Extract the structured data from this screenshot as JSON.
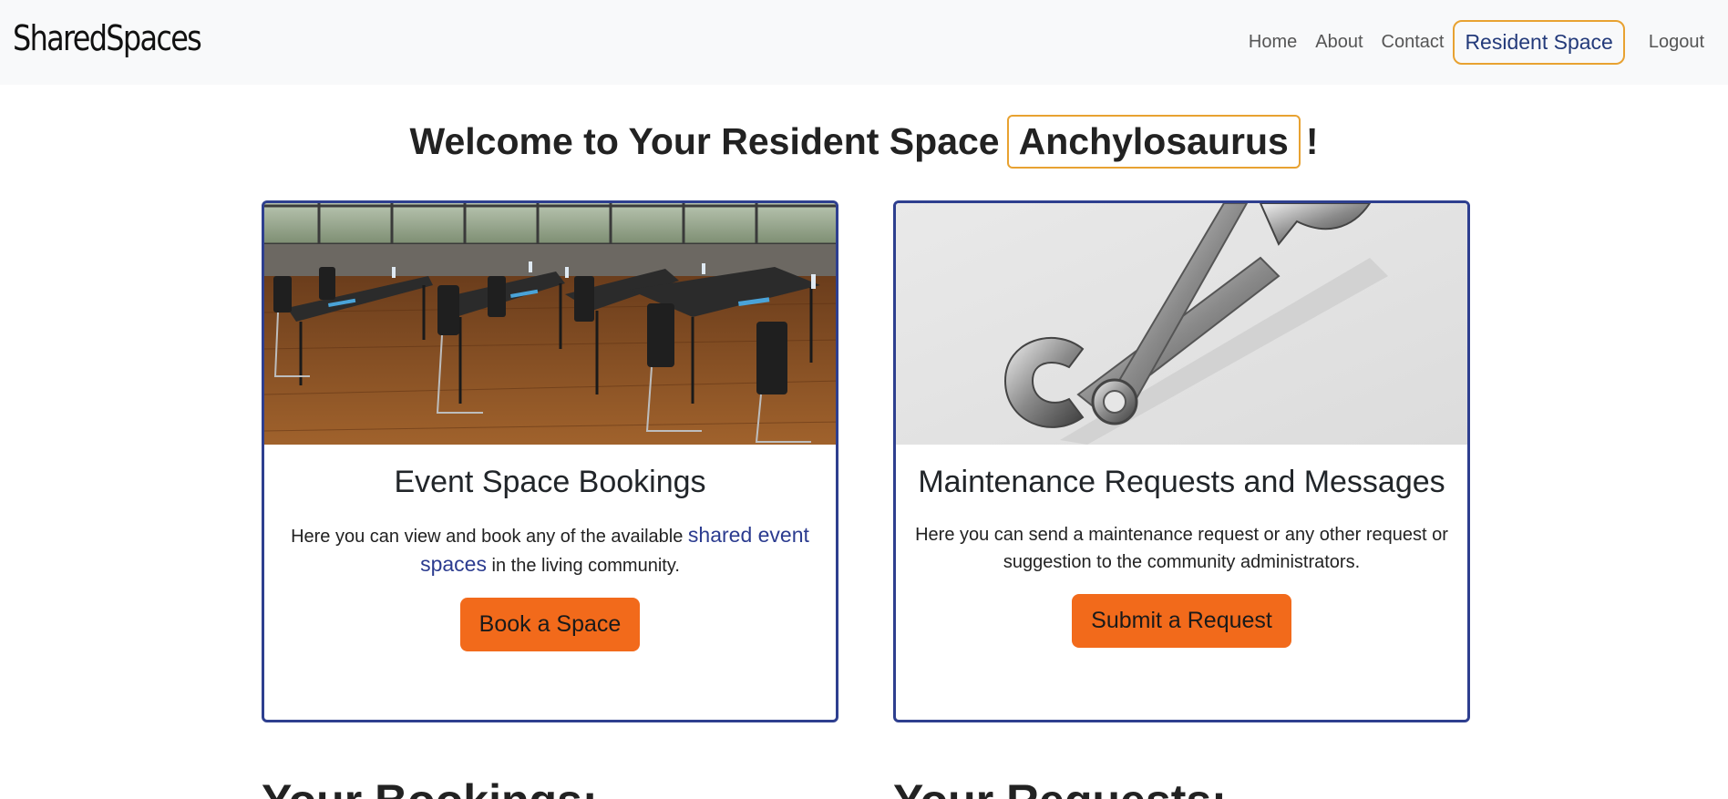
{
  "navbar": {
    "brand": "SharedSpaces",
    "links": [
      "Home",
      "About",
      "Contact"
    ],
    "active": "Resident Space",
    "logout": "Logout"
  },
  "welcome": {
    "prefix": "Welcome to Your Resident Space",
    "username": "Anchylosaurus",
    "suffix": "!"
  },
  "cards": {
    "events": {
      "title": "Event Space Bookings",
      "text_before": "Here you can view and book any of the available",
      "link": "shared event spaces",
      "text_after": "in the living community.",
      "button": "Book a Space"
    },
    "maintenance": {
      "title": "Maintenance Requests and Messages",
      "text": "Here you can send a maintenance request or any other request or suggestion to the community administrators.",
      "button": "Submit a Request"
    }
  },
  "sections": {
    "bookings": "Your Bookings:",
    "requests": "Your Requests:"
  },
  "colors": {
    "accent_orange": "#f26a1b",
    "card_border": "#2e3f8f",
    "highlight_border": "#e8a231",
    "navbar_bg": "#f8f9fa"
  }
}
